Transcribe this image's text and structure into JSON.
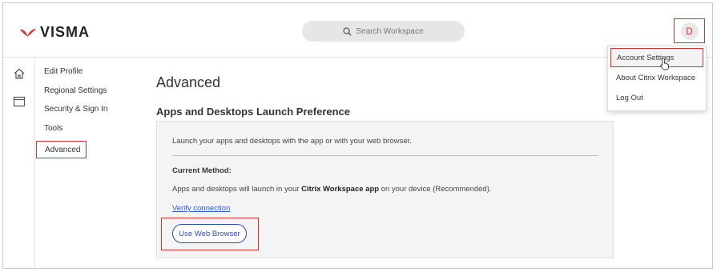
{
  "brand": {
    "name": "VISMA",
    "accent": "#d9322c"
  },
  "search": {
    "placeholder": "Search Workspace",
    "icon": "search-icon"
  },
  "user": {
    "avatar_initial": "D"
  },
  "left_rail": {
    "icons": [
      "home-icon",
      "desktop-window-icon"
    ]
  },
  "settings_nav": {
    "items": [
      {
        "label": "Edit Profile"
      },
      {
        "label": "Regional Settings"
      },
      {
        "label": "Security & Sign In"
      },
      {
        "label": "Tools"
      },
      {
        "label": "Advanced",
        "selected": true
      }
    ]
  },
  "main": {
    "title": "Advanced",
    "section_title": "Apps and Desktops Launch Preference",
    "card": {
      "description": "Launch your apps and desktops with the app or with your web browser.",
      "current_method_label": "Current Method:",
      "method_text_before": "Apps and desktops will launch in your ",
      "method_text_bold": "Citrix Workspace app",
      "method_text_after": " on your device (Recommended).",
      "verify_link": "Verify connection",
      "web_browser_button": "Use Web Browser"
    }
  },
  "user_menu": {
    "items": [
      {
        "label": "Account Settings",
        "highlighted": true
      },
      {
        "label": "About Citrix Workspace"
      },
      {
        "label": "Log Out"
      }
    ]
  },
  "colors": {
    "highlight_outline": "#d9322c",
    "link": "#2a5bd7",
    "button": "#2a4fa8"
  }
}
